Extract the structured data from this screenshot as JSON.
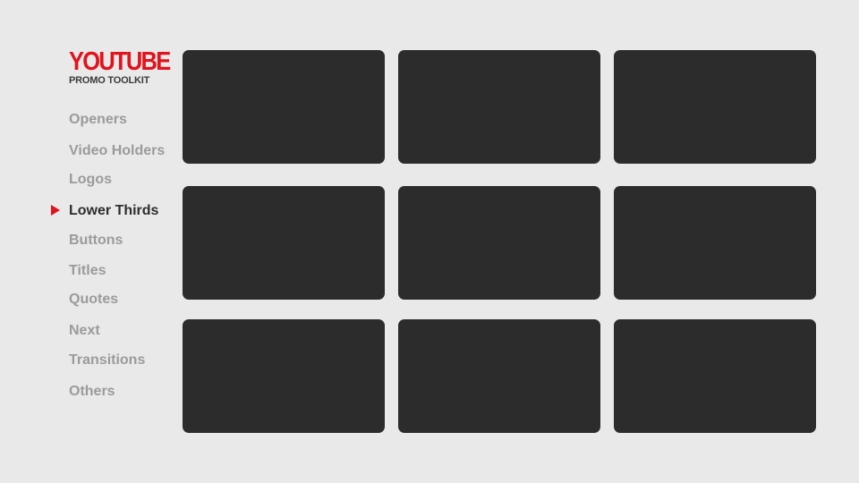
{
  "brand": {
    "title": "YOUTUBE",
    "subtitle": "PROMO TOOLKIT",
    "accent_color": "#e3121b"
  },
  "nav": {
    "items": [
      {
        "label": "Openers",
        "active": false
      },
      {
        "label": "Video Holders",
        "active": false
      },
      {
        "label": "Logos",
        "active": false
      },
      {
        "label": "Lower Thirds",
        "active": true
      },
      {
        "label": "Buttons",
        "active": false
      },
      {
        "label": "Titles",
        "active": false
      },
      {
        "label": "Quotes",
        "active": false
      },
      {
        "label": "Next",
        "active": false
      },
      {
        "label": "Transitions",
        "active": false
      },
      {
        "label": "Others",
        "active": false
      }
    ],
    "active_indicator_icon": "triangle-right-icon"
  },
  "grid": {
    "tile_color": "#2c2c2c",
    "tiles": [
      {
        "id": "tile-1"
      },
      {
        "id": "tile-2"
      },
      {
        "id": "tile-3"
      },
      {
        "id": "tile-4"
      },
      {
        "id": "tile-5"
      },
      {
        "id": "tile-6"
      },
      {
        "id": "tile-7"
      },
      {
        "id": "tile-8"
      },
      {
        "id": "tile-9"
      }
    ]
  }
}
